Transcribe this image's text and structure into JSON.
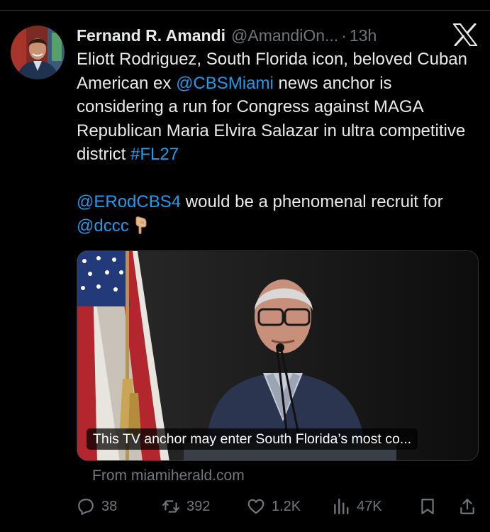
{
  "tweet": {
    "author": {
      "name": "Fernand R. Amandi",
      "handle": "@AmandiOn...",
      "avatar_icon": "profile-photo"
    },
    "separator": "·",
    "timestamp": "13h",
    "platform_icon": "x-logo-icon",
    "text": {
      "p1_a": "Eliott Rodriguez, South Florida icon, beloved Cuban American ex ",
      "mention_1": "@CBSMiami",
      "p1_b": " news anchor is considering a run for Congress against MAGA Republican Maria Elvira Salazar in ultra competitive district ",
      "hashtag_1": "#FL27",
      "mention_2": "@ERodCBS4",
      "p2_a": " would be a phenomenal recruit for ",
      "mention_3": "@dccc",
      "emoji_icon": "backhand-index-pointing-down"
    },
    "link_card": {
      "caption": "This TV anchor may enter South Florida’s most co...",
      "source": "From miamiherald.com"
    },
    "metrics": {
      "replies": "38",
      "reposts": "392",
      "likes": "1.2K",
      "views": "47K"
    }
  },
  "colors": {
    "background": "#000000",
    "text_primary": "#e7e9ea",
    "text_secondary": "#71767b",
    "link": "#1d9bf0",
    "divider": "#2f3336"
  }
}
